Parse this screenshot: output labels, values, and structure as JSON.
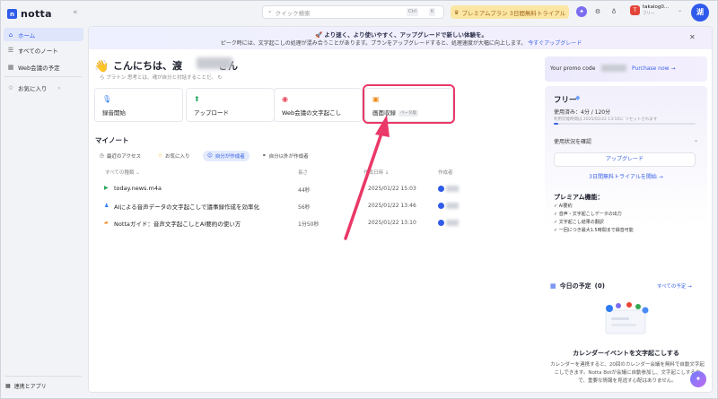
{
  "app": {
    "name": "notta",
    "collapse_icon": "«"
  },
  "sidebar": {
    "items": [
      {
        "label": "ホーム",
        "icon": "home-icon",
        "glyph": "⌂"
      },
      {
        "label": "すべてのノート",
        "icon": "list-icon",
        "glyph": "☰"
      },
      {
        "label": "Web会議の予定",
        "icon": "calendar-icon",
        "glyph": "▦"
      },
      {
        "label": "お気に入り",
        "icon": "star-icon",
        "glyph": "☆"
      }
    ],
    "favorites_chevron": "›",
    "bottom_label": "連携とアプリ"
  },
  "topbar": {
    "search_placeholder": "クイック検索",
    "kbd_ctrl": "Ctrl",
    "kbd_k": "K",
    "premium_label": "プレミアムプラン 3日間無料トライアル",
    "user_badge": "T",
    "user_name": "takalog0...",
    "user_plan": "フリー",
    "avatar": "湖"
  },
  "banner": {
    "headline": "🚀 より速く、より使いやすく、アップグレードで新しい体験を。",
    "message": "ピーク時には、文字起こしの処理が混み合うことがあります。プランをアップグレードすると、処理速度が大幅に向上します。",
    "link": "今すぐアップグレード",
    "close": "✕"
  },
  "greeting": {
    "emoji": "👋",
    "text_start": "こんにちは、渡",
    "text_end": "さん",
    "sub": "ら プラトン 思考とは、魂が自分と対話することだ。 ↻"
  },
  "actions": [
    {
      "label": "録音開始",
      "icon": "mic-icon",
      "glyph": "🎙",
      "color": "#2f7bf5"
    },
    {
      "label": "アップロード",
      "icon": "upload-icon",
      "glyph": "⬆",
      "color": "#22a55b"
    },
    {
      "label": "Web会議の文字起こし",
      "icon": "meeting-icon",
      "glyph": "◉",
      "color": "#e8475a"
    },
    {
      "label": "画面収録",
      "icon": "screen-record-icon",
      "glyph": "▣",
      "color": "#f08c1e",
      "badge": "ベータ版"
    }
  ],
  "notes": {
    "title": "マイノート",
    "filters": [
      {
        "label": "最近のアクセス",
        "glyph": "◷"
      },
      {
        "label": "お気に入り",
        "glyph": "☆"
      },
      {
        "label": "自分が作成者",
        "glyph": "☺"
      },
      {
        "label": "自分以外が作成者",
        "glyph": "⚭"
      }
    ],
    "columns": {
      "type": "すべての種類 ⌄",
      "length": "長さ",
      "created": "作成日時 ↓",
      "owner": "作成者"
    },
    "rows": [
      {
        "name": "today.news.m4a",
        "glyph": "▶",
        "color": "#22a55b",
        "length": "44秒",
        "created": "2025/01/22 15:03",
        "owner": "湖"
      },
      {
        "name": "AIによる音声データの文字起こしで議事録作成を効率化",
        "glyph": "♟",
        "color": "#2f7bf5",
        "length": "56秒",
        "created": "2025/01/22 13:46",
        "owner": "湖"
      },
      {
        "name": "Nottaガイド：音声文字起こしとAI要約の使い方",
        "glyph": "▰",
        "color": "#f08c1e",
        "length": "1分50秒",
        "created": "2025/01/22 13:10",
        "owner": "湖"
      }
    ]
  },
  "plan": {
    "promo_text": "Your promo code",
    "promo_link": "Purchase now →",
    "name": "フリー",
    "diamond": "◆",
    "usage": "使用済み：4分 / 120分",
    "usage_fraction": 0.033,
    "reset": "利用可能時間は 2025/02/22 13:10に リセットされます",
    "check_usage": "使用状況を確認",
    "upgrade": "アップグレード",
    "trial": "3日間無料トライアルを開始 →",
    "features_title": "プレミアム機能：",
    "features": [
      "AI要約",
      "音声・文字起こしデータの出力",
      "文字起こし結果の翻訳",
      "一回につき最大1.5時間まで録音可能"
    ]
  },
  "calendar": {
    "title": "今日の予定",
    "count": "(0)",
    "link": "すべての予定 →",
    "heading": "カレンダーイベントを文字起こしする",
    "desc": "カレンダーを連携すると、20回のカレンダー会議を無料で自動文字起こしできます。Notta Botが会議に自動参加し、文字起こしするので、重要な情報を見逃す心配はありません。"
  },
  "colors": {
    "accent": "#2f5bea",
    "highlight": "#ea3868"
  }
}
